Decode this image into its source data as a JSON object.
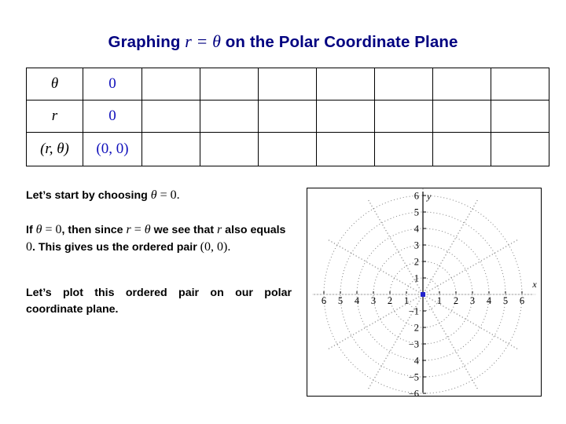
{
  "slide": {
    "title_prefix": "Graphing ",
    "title_r": "r",
    "title_eq": " = ",
    "title_theta": "θ",
    "title_suffix": " on the Polar Coordinate Plane",
    "title_color": "#000080"
  },
  "table": {
    "columns": 9,
    "rows": [
      {
        "label": "θ",
        "label_style": "greek-italic",
        "values": [
          "0",
          "",
          "",
          "",
          "",
          "",
          "",
          ""
        ]
      },
      {
        "label": "r",
        "label_style": "italic",
        "values": [
          "0",
          "",
          "",
          "",
          "",
          "",
          "",
          ""
        ]
      },
      {
        "label": "(r, θ)",
        "label_style": "italic",
        "values": [
          "(0, 0)",
          "",
          "",
          "",
          "",
          "",
          "",
          ""
        ]
      }
    ],
    "value_color": "#1111bb",
    "border_color": "#000000"
  },
  "text": {
    "para1": {
      "part1": "Let’s start by choosing ",
      "theta": "θ",
      "eq": " = ",
      "zero": "0",
      "part2": "."
    },
    "para2": {
      "p1": "If ",
      "theta1": "θ",
      "eq1": " = ",
      "zero1": "0",
      "p2": ", then since ",
      "r1": "r",
      "eq2": " = ",
      "theta2": "θ",
      "p3": " we see that ",
      "r2": "r",
      "p4": " also equals ",
      "zero2": "0",
      "p5": ".  This gives us the ordered pair ",
      "pair": "(0, 0)",
      "p6": "."
    },
    "para3": "Let’s plot this ordered pair on our polar coordinate plane."
  },
  "chart_data": {
    "type": "scatter",
    "title": "",
    "xlabel": "x",
    "ylabel": "y",
    "xlim": [
      -6.75,
      6.75
    ],
    "ylim": [
      -6.5,
      6.5
    ],
    "xticks": [
      -6,
      -5,
      -4,
      -3,
      -2,
      -1,
      1,
      2,
      3,
      4,
      5,
      6
    ],
    "xticklabels": [
      "6",
      "5",
      "4",
      "3",
      "2",
      "1",
      "1",
      "2",
      "3",
      "4",
      "5",
      "6"
    ],
    "yticks": [
      -6,
      -5,
      -4,
      -3,
      -2,
      -1,
      1,
      2,
      3,
      4,
      5,
      6
    ],
    "yticklabels": [
      "−6",
      "−5",
      "4",
      "−3",
      "2",
      "−1",
      "1",
      "2",
      "3",
      "4",
      "5",
      "6"
    ],
    "grid": "polar-dotted",
    "polar_grid": {
      "circle_radii": [
        1,
        2,
        3,
        4,
        5,
        6
      ],
      "radial_lines_deg": [
        0,
        30,
        60,
        90,
        120,
        150,
        180,
        210,
        240,
        270,
        300,
        330
      ],
      "grid_color": "#808080",
      "style": "dotted"
    },
    "points": [
      {
        "label": "(0, 0)",
        "r": 0,
        "theta": 0,
        "x": 0,
        "y": 0,
        "color": "#2222cc",
        "marker": "square"
      }
    ],
    "axis_color": "#000000",
    "frame": true,
    "legend": null
  }
}
